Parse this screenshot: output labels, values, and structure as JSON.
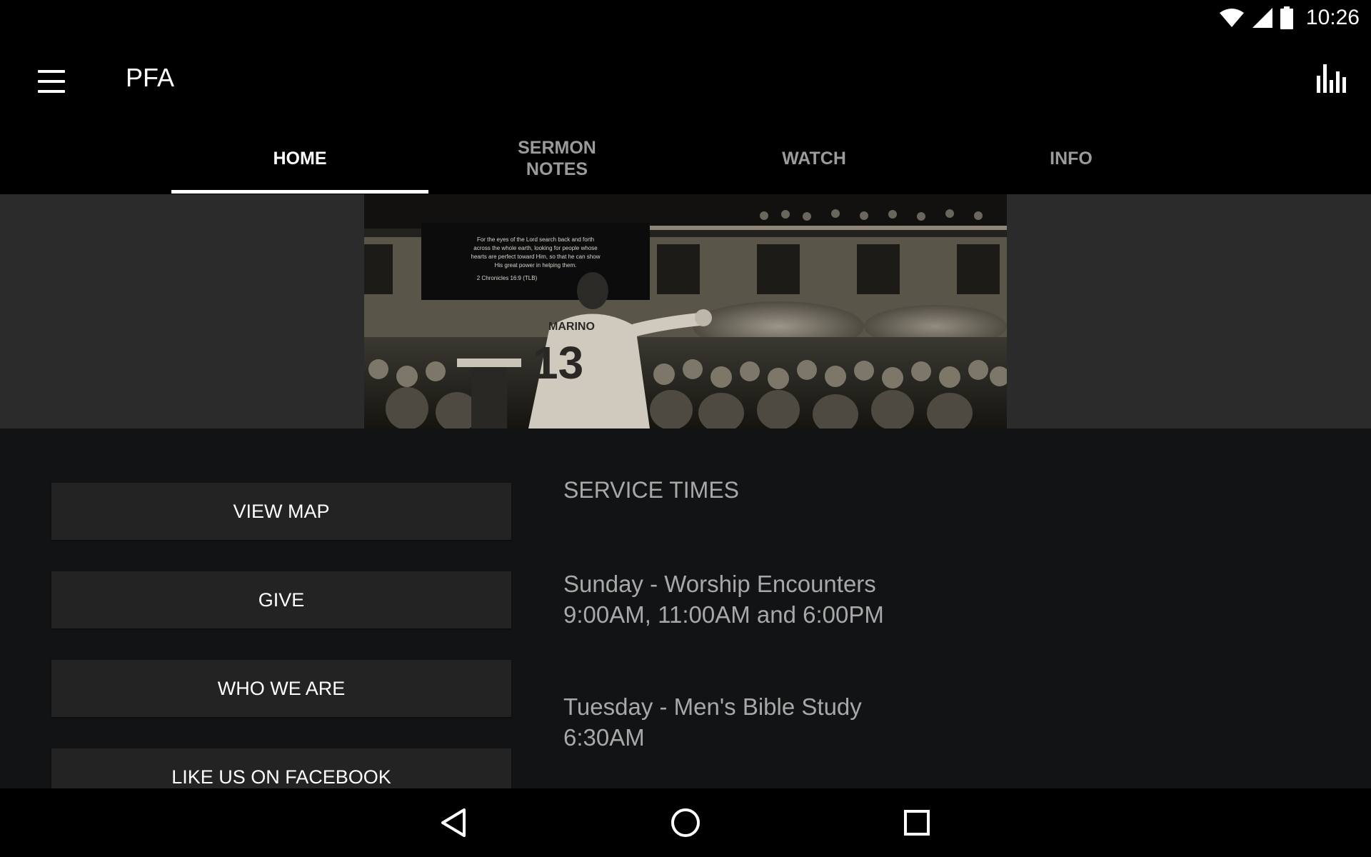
{
  "status_bar": {
    "time": "10:26"
  },
  "app_bar": {
    "title": "PFA"
  },
  "tabs": [
    {
      "label": "HOME",
      "active": true
    },
    {
      "label": "SERMON\nNOTES",
      "active": false
    },
    {
      "label": "WATCH",
      "active": false
    },
    {
      "label": "INFO",
      "active": false
    }
  ],
  "hero": {
    "slide_text": "For the eyes of the Lord search back and forth across the whole earth, looking for people whose hearts are perfect toward Him, so that he can show His great power in helping them.",
    "slide_ref": "2 Chronicles 16:9 (TLB)",
    "jersey_name": "MARINO",
    "jersey_number": "13"
  },
  "buttons": {
    "view_map": "VIEW MAP",
    "give": "GIVE",
    "who_we_are": "WHO WE ARE",
    "facebook": "LIKE US ON FACEBOOK"
  },
  "service_times": {
    "title": "SERVICE TIMES",
    "items": [
      {
        "name": "Sunday - Worship Encounters",
        "times": "9:00AM, 11:00AM and 6:00PM"
      },
      {
        "name": "Tuesday - Men's Bible Study",
        "times": "6:30AM"
      }
    ]
  },
  "colors": {
    "background": "#121315",
    "bar": "#000000",
    "button": "#232323",
    "muted_text": "#a8a8a8",
    "inactive_tab": "#9b9b9b"
  }
}
